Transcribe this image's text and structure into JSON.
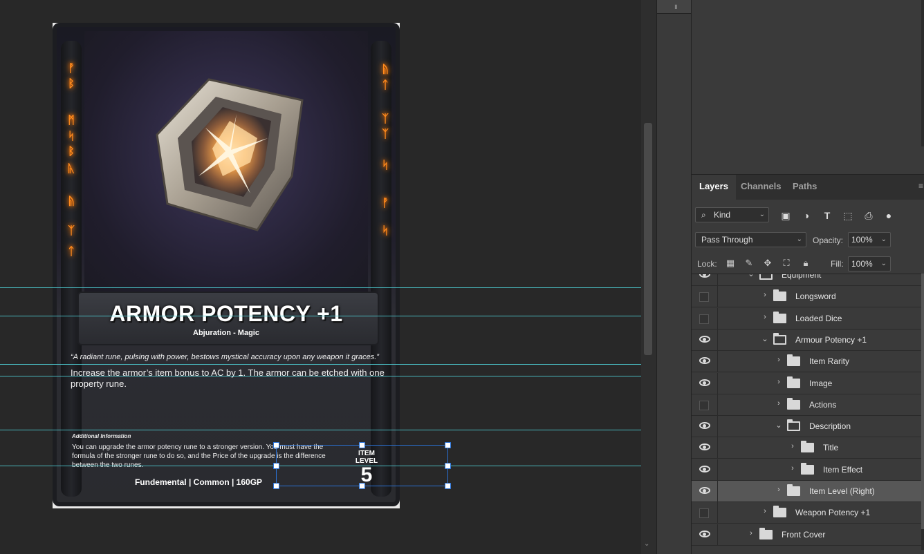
{
  "card": {
    "title": "ARMOR POTENCY +1",
    "subtitle": "Abjuration - Magic",
    "flavor": "“A radiant rune, pulsing with power, bestows mystical accuracy upon any weapon it graces.”",
    "effect": "Increase the armor’s item bonus to AC by 1. The armor can be etched with one property rune.",
    "additional_title": "Additional Information",
    "additional_text": "You can upgrade the armor potency rune to a stronger version. You must have the formula of the stronger rune to do so, and the Price of the upgrade is the difference between the two runes.",
    "footer": "Fundemental | Common | 160GP",
    "item_level_label": "ITEM LEVEL",
    "item_level_value": "5",
    "runes_left": [
      "ᚡ",
      "ᛒ",
      "ᛗ",
      "ᛋ",
      "ᛒ",
      "ᚣ",
      "ᚥ",
      "ᛉ",
      "ᛏ"
    ],
    "runes_right": [
      "ᚥ",
      "ᛏ",
      "ᛉ",
      "ᛉ",
      "ᛋ",
      "ᚡ",
      "ᛋ"
    ]
  },
  "panel": {
    "tabs": [
      "Layers",
      "Channels",
      "Paths"
    ],
    "active_tab": "Layers",
    "filter_kind": "Kind",
    "blend_mode": "Pass Through",
    "opacity_label": "Opacity:",
    "opacity_value": "100%",
    "lock_label": "Lock:",
    "fill_label": "Fill:",
    "fill_value": "100%"
  },
  "layers": [
    {
      "name": "Equipment",
      "visible": true,
      "indent": 0,
      "expanded": true,
      "selected": false
    },
    {
      "name": "Longsword",
      "visible": false,
      "indent": 1,
      "expanded": false,
      "selected": false
    },
    {
      "name": "Loaded Dice",
      "visible": false,
      "indent": 1,
      "expanded": false,
      "selected": false
    },
    {
      "name": "Armour Potency +1",
      "visible": true,
      "indent": 1,
      "expanded": true,
      "selected": false
    },
    {
      "name": "Item Rarity",
      "visible": true,
      "indent": 2,
      "expanded": false,
      "selected": false
    },
    {
      "name": "Image",
      "visible": true,
      "indent": 2,
      "expanded": false,
      "selected": false
    },
    {
      "name": "Actions",
      "visible": false,
      "indent": 2,
      "expanded": false,
      "selected": false
    },
    {
      "name": "Description",
      "visible": true,
      "indent": 2,
      "expanded": true,
      "selected": false
    },
    {
      "name": "Title",
      "visible": true,
      "indent": 3,
      "expanded": false,
      "selected": false
    },
    {
      "name": "Item Effect",
      "visible": true,
      "indent": 3,
      "expanded": false,
      "selected": false
    },
    {
      "name": "Item Level (Right)",
      "visible": true,
      "indent": 2,
      "expanded": false,
      "selected": true
    },
    {
      "name": "Weapon Potency +1",
      "visible": false,
      "indent": 1,
      "expanded": false,
      "selected": false
    },
    {
      "name": "Front Cover",
      "visible": true,
      "indent": 0,
      "expanded": false,
      "selected": false
    }
  ]
}
